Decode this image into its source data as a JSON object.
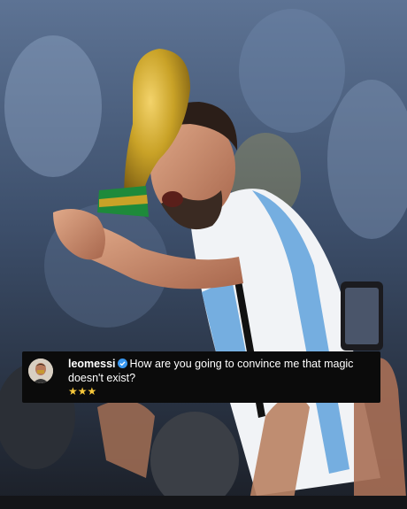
{
  "comment": {
    "username": "leomessi",
    "text": "How are you going to convince me that magic doesn't exist?",
    "stars": "★★★",
    "verified_icon": "verified-badge-icon",
    "star_color": "#f7c83b",
    "verified_color": "#3897f0"
  },
  "photo": {
    "subject": "photo-content",
    "jersey_stripe_color": "#75aee0",
    "trophy_color": "#c9a227",
    "trophy_base_color": "#1e8a3b"
  }
}
